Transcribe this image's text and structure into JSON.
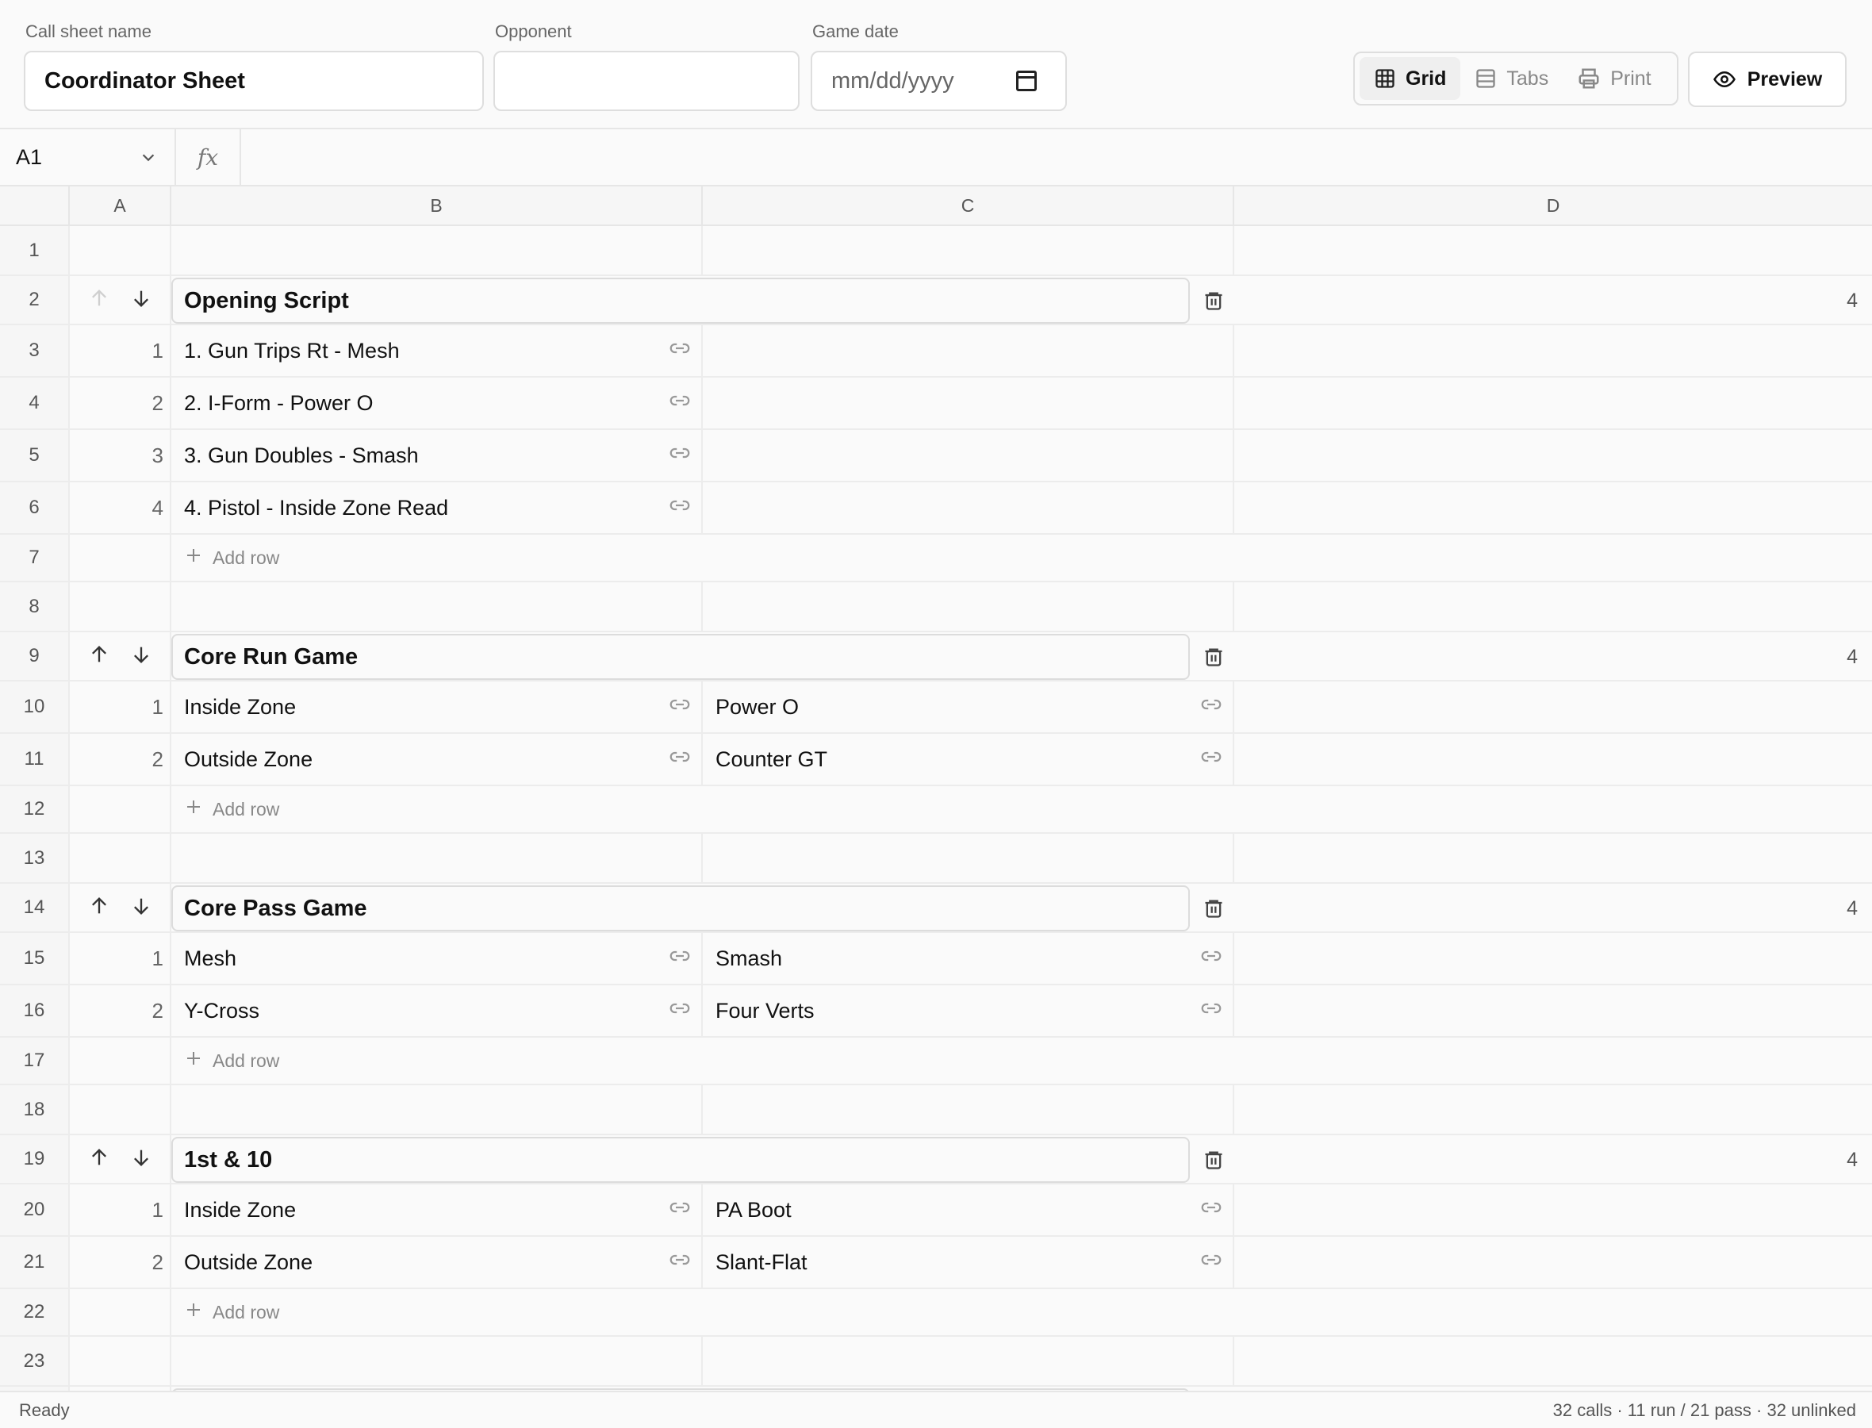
{
  "header": {
    "sheet_name_label": "Call sheet name",
    "sheet_name_value": "Coordinator Sheet",
    "opponent_label": "Opponent",
    "opponent_value": "",
    "game_date_label": "Game date",
    "game_date_placeholder": "mm/dd/yyyy",
    "views": [
      {
        "label": "Grid",
        "active": true,
        "icon": "grid-icon"
      },
      {
        "label": "Tabs",
        "active": false,
        "icon": "tabs-icon"
      },
      {
        "label": "Print",
        "active": false,
        "icon": "printer-icon"
      }
    ],
    "preview_label": "Preview"
  },
  "formula_bar": {
    "cell_ref": "A1",
    "fx_label": "fx",
    "formula": ""
  },
  "columns": [
    "A",
    "B",
    "C",
    "D"
  ],
  "rows": [
    {
      "n": "1",
      "kind": "empty"
    },
    {
      "n": "2",
      "kind": "group",
      "title": "Opening Script",
      "count": "4",
      "up_enabled": false
    },
    {
      "n": "3",
      "kind": "play",
      "idx": "1",
      "b": "1. Gun Trips Rt - Mesh",
      "c": ""
    },
    {
      "n": "4",
      "kind": "play",
      "idx": "2",
      "b": "2. I-Form - Power O",
      "c": ""
    },
    {
      "n": "5",
      "kind": "play",
      "idx": "3",
      "b": "3. Gun Doubles - Smash",
      "c": ""
    },
    {
      "n": "6",
      "kind": "play",
      "idx": "4",
      "b": "4. Pistol - Inside Zone Read",
      "c": ""
    },
    {
      "n": "7",
      "kind": "add",
      "label": "Add row"
    },
    {
      "n": "8",
      "kind": "empty"
    },
    {
      "n": "9",
      "kind": "group",
      "title": "Core Run Game",
      "count": "4",
      "up_enabled": true
    },
    {
      "n": "10",
      "kind": "play",
      "idx": "1",
      "b": "Inside Zone",
      "c": "Power O"
    },
    {
      "n": "11",
      "kind": "play",
      "idx": "2",
      "b": "Outside Zone",
      "c": "Counter GT"
    },
    {
      "n": "12",
      "kind": "add",
      "label": "Add row"
    },
    {
      "n": "13",
      "kind": "empty"
    },
    {
      "n": "14",
      "kind": "group",
      "title": "Core Pass Game",
      "count": "4",
      "up_enabled": true
    },
    {
      "n": "15",
      "kind": "play",
      "idx": "1",
      "b": "Mesh",
      "c": "Smash"
    },
    {
      "n": "16",
      "kind": "play",
      "idx": "2",
      "b": "Y-Cross",
      "c": "Four Verts"
    },
    {
      "n": "17",
      "kind": "add",
      "label": "Add row"
    },
    {
      "n": "18",
      "kind": "empty"
    },
    {
      "n": "19",
      "kind": "group",
      "title": "1st & 10",
      "count": "4",
      "up_enabled": true
    },
    {
      "n": "20",
      "kind": "play",
      "idx": "1",
      "b": "Inside Zone",
      "c": "PA Boot"
    },
    {
      "n": "21",
      "kind": "play",
      "idx": "2",
      "b": "Outside Zone",
      "c": "Slant-Flat"
    },
    {
      "n": "22",
      "kind": "add",
      "label": "Add row"
    },
    {
      "n": "23",
      "kind": "empty"
    },
    {
      "n": "",
      "kind": "group-partial",
      "title": "",
      "count": "",
      "up_enabled": true
    }
  ],
  "status": {
    "left": "Ready",
    "right": "32 calls · 11 run / 21 pass · 32 unlinked"
  }
}
